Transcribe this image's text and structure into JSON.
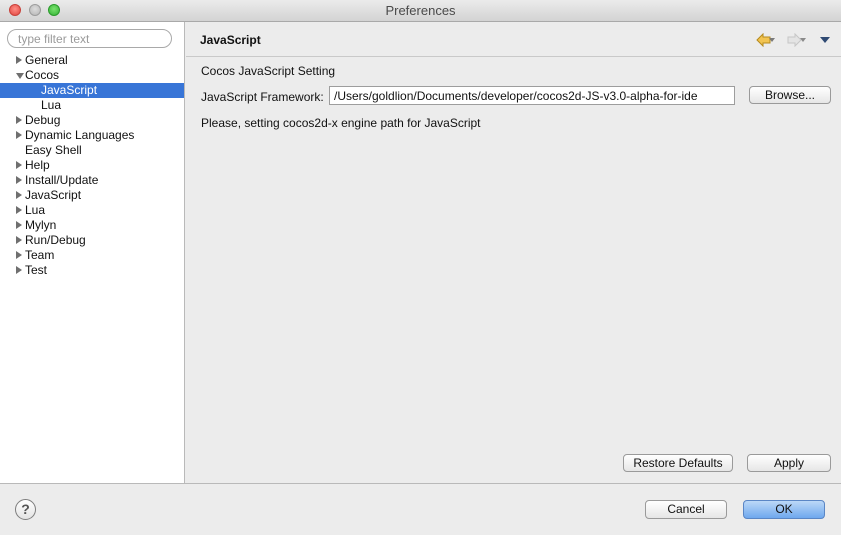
{
  "window": {
    "title": "Preferences"
  },
  "sidebar": {
    "filter_placeholder": "type filter text",
    "items": [
      {
        "label": "General",
        "expander": "right",
        "indent": 0
      },
      {
        "label": "Cocos",
        "expander": "down",
        "indent": 0
      },
      {
        "label": "JavaScript",
        "expander": "none",
        "indent": 1,
        "selected": true
      },
      {
        "label": "Lua",
        "expander": "none",
        "indent": 1
      },
      {
        "label": "Debug",
        "expander": "right",
        "indent": 0
      },
      {
        "label": "Dynamic Languages",
        "expander": "right",
        "indent": 0
      },
      {
        "label": "Easy Shell",
        "expander": "none",
        "indent": 0
      },
      {
        "label": "Help",
        "expander": "right",
        "indent": 0
      },
      {
        "label": "Install/Update",
        "expander": "right",
        "indent": 0
      },
      {
        "label": "JavaScript",
        "expander": "right",
        "indent": 0
      },
      {
        "label": "Lua",
        "expander": "right",
        "indent": 0
      },
      {
        "label": "Mylyn",
        "expander": "right",
        "indent": 0
      },
      {
        "label": "Run/Debug",
        "expander": "right",
        "indent": 0
      },
      {
        "label": "Team",
        "expander": "right",
        "indent": 0
      },
      {
        "label": "Test",
        "expander": "right",
        "indent": 0
      }
    ]
  },
  "page": {
    "title": "JavaScript",
    "section_label": "Cocos JavaScript Setting",
    "framework_label": "JavaScript Framework:",
    "framework_value": "/Users/goldlion/Documents/developer/cocos2d-JS-v3.0-alpha-for-ide",
    "browse_label": "Browse...",
    "message": "Please, setting cocos2d-x engine path for JavaScript",
    "restore_defaults_label": "Restore Defaults",
    "apply_label": "Apply"
  },
  "footer": {
    "help_glyph": "?",
    "cancel_label": "Cancel",
    "ok_label": "OK"
  },
  "icons": {
    "back": "back-arrow-icon",
    "forward": "forward-arrow-icon",
    "menu": "view-menu-icon",
    "help": "help-icon"
  },
  "colors": {
    "selection": "#3875d7",
    "back_arrow": "#e8b53a",
    "ok_button": "#6fa8ee"
  }
}
